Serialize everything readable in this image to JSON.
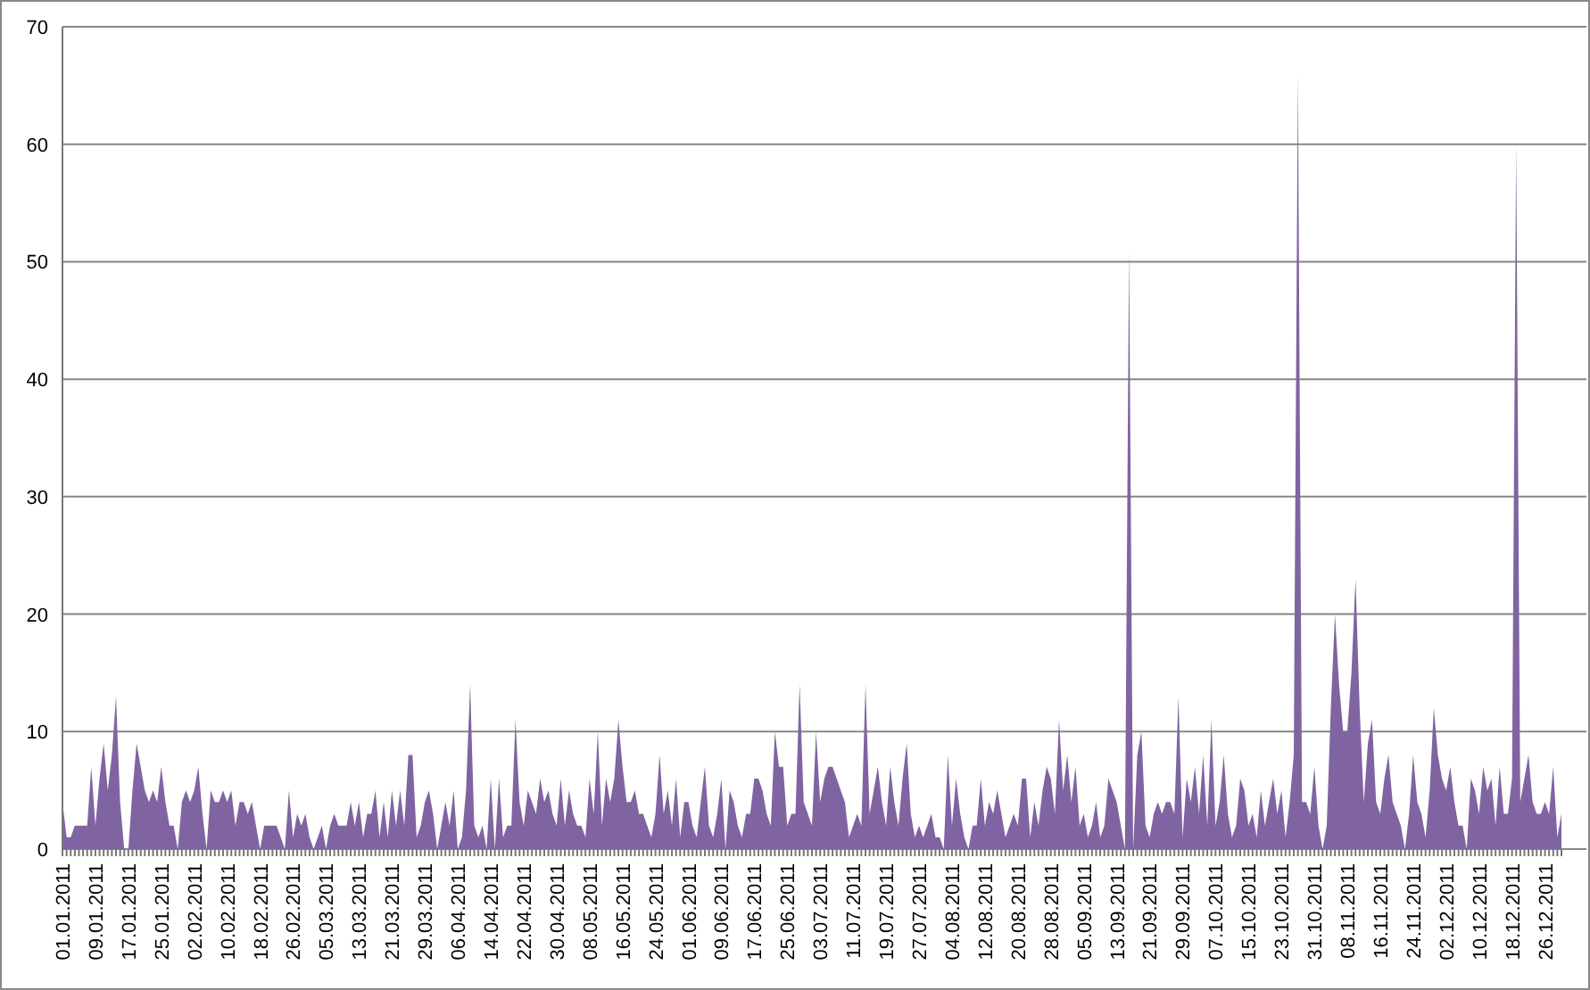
{
  "chart_data": {
    "type": "area",
    "ylim": [
      0,
      70
    ],
    "yticks": [
      0,
      10,
      20,
      30,
      40,
      50,
      60,
      70
    ],
    "grid": true,
    "categories": [
      "01.01.2011",
      null,
      null,
      null,
      null,
      null,
      null,
      null,
      "09.01.2011",
      null,
      null,
      null,
      null,
      null,
      null,
      null,
      "17.01.2011",
      null,
      null,
      null,
      null,
      null,
      null,
      null,
      "25.01.2011",
      null,
      null,
      null,
      null,
      null,
      null,
      null,
      "02.02.2011",
      null,
      null,
      null,
      null,
      null,
      null,
      null,
      "10.02.2011",
      null,
      null,
      null,
      null,
      null,
      null,
      null,
      "18.02.2011",
      null,
      null,
      null,
      null,
      null,
      null,
      null,
      "26.02.2011",
      null,
      null,
      null,
      null,
      null,
      null,
      null,
      "05.03.2011",
      null,
      null,
      null,
      null,
      null,
      null,
      null,
      "13.03.2011",
      null,
      null,
      null,
      null,
      null,
      null,
      null,
      "21.03.2011",
      null,
      null,
      null,
      null,
      null,
      null,
      null,
      "29.03.2011",
      null,
      null,
      null,
      null,
      null,
      null,
      null,
      "06.04.2011",
      null,
      null,
      null,
      null,
      null,
      null,
      null,
      "14.04.2011",
      null,
      null,
      null,
      null,
      null,
      null,
      null,
      "22.04.2011",
      null,
      null,
      null,
      null,
      null,
      null,
      null,
      "30.04.2011",
      null,
      null,
      null,
      null,
      null,
      null,
      null,
      "08.05.2011",
      null,
      null,
      null,
      null,
      null,
      null,
      null,
      "16.05.2011",
      null,
      null,
      null,
      null,
      null,
      null,
      null,
      "24.05.2011",
      null,
      null,
      null,
      null,
      null,
      null,
      null,
      "01.06.2011",
      null,
      null,
      null,
      null,
      null,
      null,
      null,
      "09.06.2011",
      null,
      null,
      null,
      null,
      null,
      null,
      null,
      "17.06.2011",
      null,
      null,
      null,
      null,
      null,
      null,
      null,
      "25.06.2011",
      null,
      null,
      null,
      null,
      null,
      null,
      null,
      "03.07.2011",
      null,
      null,
      null,
      null,
      null,
      null,
      null,
      "11.07.2011",
      null,
      null,
      null,
      null,
      null,
      null,
      null,
      "19.07.2011",
      null,
      null,
      null,
      null,
      null,
      null,
      null,
      "27.07.2011",
      null,
      null,
      null,
      null,
      null,
      null,
      null,
      "04.08.2011",
      null,
      null,
      null,
      null,
      null,
      null,
      null,
      "12.08.2011",
      null,
      null,
      null,
      null,
      null,
      null,
      null,
      "20.08.2011",
      null,
      null,
      null,
      null,
      null,
      null,
      null,
      "28.08.2011",
      null,
      null,
      null,
      null,
      null,
      null,
      null,
      "05.09.2011",
      null,
      null,
      null,
      null,
      null,
      null,
      null,
      "13.09.2011",
      null,
      null,
      null,
      null,
      null,
      null,
      null,
      "21.09.2011",
      null,
      null,
      null,
      null,
      null,
      null,
      null,
      "29.09.2011",
      null,
      null,
      null,
      null,
      null,
      null,
      null,
      "07.10.2011",
      null,
      null,
      null,
      null,
      null,
      null,
      null,
      "15.10.2011",
      null,
      null,
      null,
      null,
      null,
      null,
      null,
      "23.10.2011",
      null,
      null,
      null,
      null,
      null,
      null,
      null,
      "31.10.2011",
      null,
      null,
      null,
      null,
      null,
      null,
      null,
      "08.11.2011",
      null,
      null,
      null,
      null,
      null,
      null,
      null,
      "16.11.2011",
      null,
      null,
      null,
      null,
      null,
      null,
      null,
      "24.11.2011",
      null,
      null,
      null,
      null,
      null,
      null,
      null,
      "02.12.2011",
      null,
      null,
      null,
      null,
      null,
      null,
      null,
      "10.12.2011",
      null,
      null,
      null,
      null,
      null,
      null,
      null,
      "18.12.2011",
      null,
      null,
      null,
      null,
      null,
      null,
      null,
      "26.12.2011",
      null,
      null,
      null,
      null
    ],
    "series": [
      {
        "color": "#8064a2",
        "values": [
          4,
          1,
          1,
          2,
          2,
          2,
          2,
          7,
          2,
          6,
          9,
          5,
          8,
          13,
          4,
          0,
          0,
          5,
          9,
          7,
          5,
          4,
          5,
          4,
          7,
          4,
          2,
          2,
          0,
          4,
          5,
          4,
          5,
          7,
          3,
          0,
          5,
          4,
          4,
          5,
          4,
          5,
          2,
          4,
          4,
          3,
          4,
          2,
          0,
          2,
          2,
          2,
          2,
          1,
          0,
          5,
          1,
          3,
          2,
          3,
          1,
          0,
          1,
          2,
          0,
          2,
          3,
          2,
          2,
          2,
          4,
          2,
          4,
          1,
          3,
          3,
          5,
          1,
          4,
          1,
          5,
          2,
          5,
          2,
          8,
          8,
          1,
          2,
          4,
          5,
          3,
          0,
          2,
          4,
          2,
          5,
          0,
          1,
          5,
          14,
          2,
          1,
          2,
          0,
          6,
          0,
          6,
          1,
          2,
          2,
          11,
          4,
          2,
          5,
          4,
          3,
          6,
          4,
          5,
          3,
          2,
          6,
          2,
          5,
          3,
          2,
          2,
          1,
          6,
          3,
          10,
          2,
          6,
          4,
          6,
          11,
          7,
          4,
          4,
          5,
          3,
          3,
          2,
          1,
          3,
          8,
          3,
          5,
          2,
          6,
          1,
          4,
          4,
          2,
          1,
          4,
          7,
          2,
          1,
          3,
          6,
          0,
          5,
          4,
          2,
          1,
          3,
          3,
          6,
          6,
          5,
          3,
          2,
          10,
          7,
          7,
          2,
          3,
          3,
          14,
          4,
          3,
          2,
          10,
          4,
          6,
          7,
          7,
          6,
          5,
          4,
          1,
          2,
          3,
          2,
          14,
          3,
          5,
          7,
          4,
          2,
          7,
          4,
          2,
          6,
          9,
          3,
          1,
          2,
          1,
          2,
          3,
          1,
          1,
          0,
          8,
          2,
          6,
          3,
          1,
          0,
          2,
          2,
          6,
          2,
          4,
          3,
          5,
          3,
          1,
          2,
          3,
          2,
          6,
          6,
          1,
          4,
          2,
          5,
          7,
          6,
          3,
          11,
          5,
          8,
          4,
          7,
          2,
          3,
          1,
          2,
          4,
          1,
          2,
          6,
          5,
          4,
          2,
          0,
          51,
          0,
          8,
          10,
          2,
          1,
          3,
          4,
          3,
          4,
          4,
          3,
          13,
          1,
          6,
          4,
          7,
          3,
          8,
          2,
          11,
          2,
          4,
          8,
          3,
          1,
          2,
          6,
          5,
          2,
          3,
          1,
          5,
          2,
          4,
          6,
          3,
          5,
          1,
          4,
          8,
          66,
          4,
          4,
          3,
          7,
          2,
          0,
          2,
          12,
          20,
          14,
          10,
          10,
          15,
          23,
          12,
          4,
          9,
          11,
          4,
          3,
          6,
          8,
          4,
          3,
          2,
          0,
          3,
          8,
          4,
          3,
          1,
          5,
          12,
          8,
          6,
          5,
          7,
          4,
          2,
          2,
          0,
          6,
          5,
          3,
          7,
          5,
          6,
          2,
          7,
          3,
          3,
          6,
          60,
          4,
          6,
          8,
          4,
          3,
          3,
          4,
          3,
          7,
          1,
          3
        ]
      }
    ]
  }
}
